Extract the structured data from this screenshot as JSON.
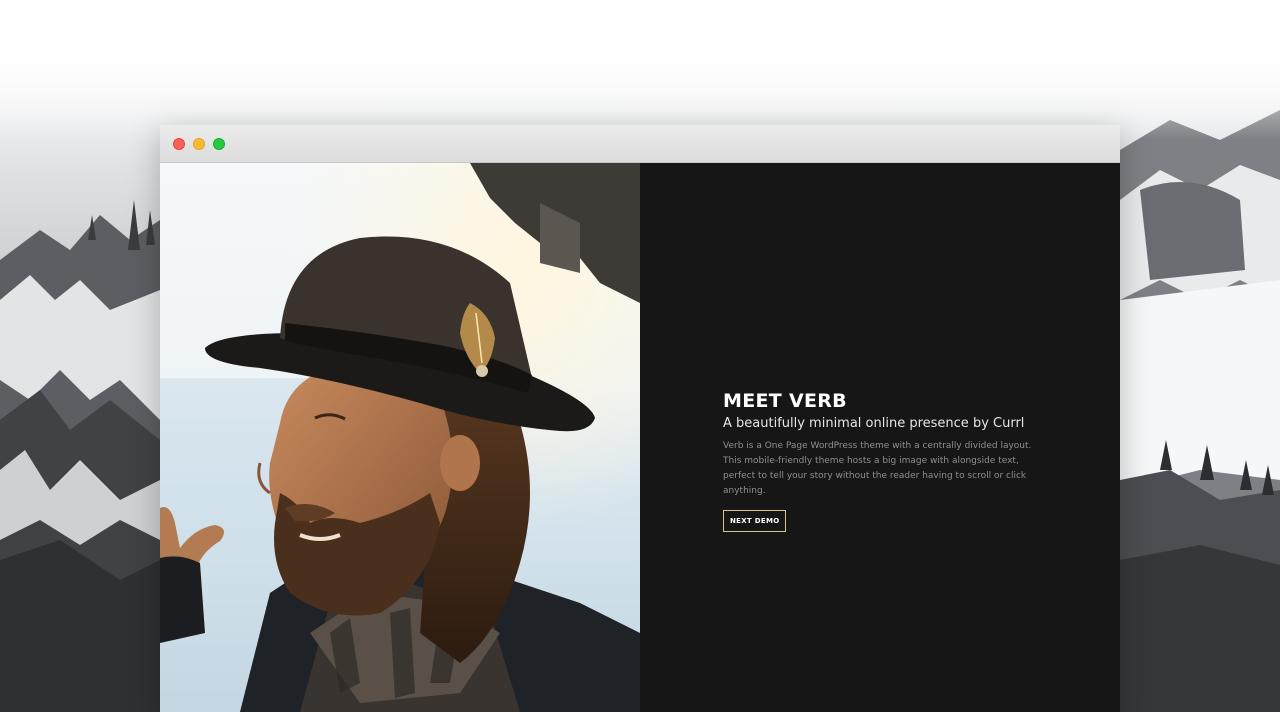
{
  "window": {
    "buttons": [
      "close",
      "minimize",
      "maximize"
    ]
  },
  "hero": {
    "image": "portrait-of-bearded-man-in-hat",
    "headline": "MEET VERB",
    "subtitle": "A beautifully minimal online presence by Currl",
    "description": "Verb is a One Page WordPress theme with a centrally divided layout. This mobile-friendly theme hosts a big image with alongside text, perfect to tell your story without the reader having to scroll or click anything.",
    "cta_label": "NEXT DEMO"
  },
  "colors": {
    "panel_background": "#161616",
    "accent_border": "#d7c290",
    "close_dot": "#fc5f57",
    "minimize_dot": "#fdbc2e",
    "maximize_dot": "#28c840"
  }
}
